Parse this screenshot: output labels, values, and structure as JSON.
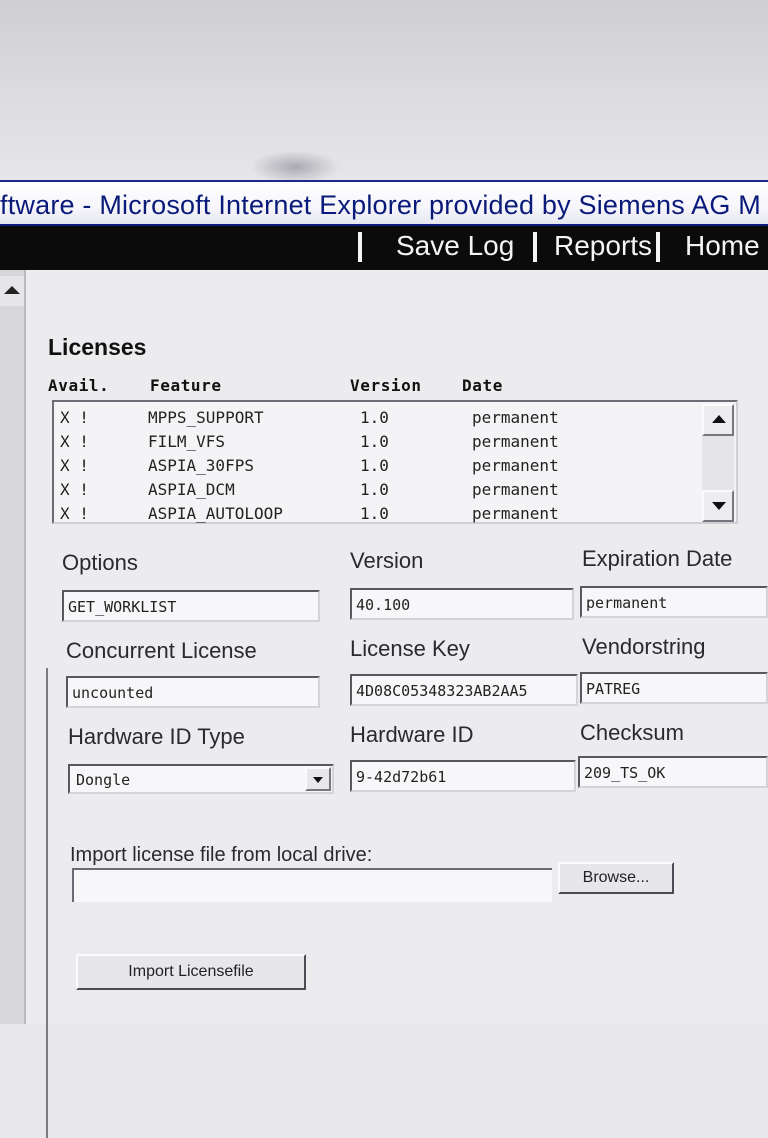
{
  "window": {
    "title": "ftware - Microsoft Internet Explorer provided by Siemens AG M"
  },
  "nav": {
    "save_log": "Save Log",
    "reports": "Reports",
    "home": "Home"
  },
  "licenses": {
    "title": "Licenses",
    "columns": {
      "avail": "Avail.",
      "feature": "Feature",
      "version": "Version",
      "date": "Date"
    },
    "rows": [
      {
        "avail": "X !",
        "feature": "MPPS_SUPPORT",
        "version": "1.0",
        "date": "permanent"
      },
      {
        "avail": "X !",
        "feature": "FILM_VFS",
        "version": "1.0",
        "date": "permanent"
      },
      {
        "avail": "X !",
        "feature": "ASPIA_30FPS",
        "version": "1.0",
        "date": "permanent"
      },
      {
        "avail": "X !",
        "feature": "ASPIA_DCM",
        "version": "1.0",
        "date": "permanent"
      },
      {
        "avail": "X !",
        "feature": "ASPIA_AUTOLOOP",
        "version": "1.0",
        "date": "permanent"
      }
    ]
  },
  "fields": {
    "options": {
      "label": "Options",
      "value": "GET_WORKLIST"
    },
    "version": {
      "label": "Version",
      "value": "40.100"
    },
    "expiration": {
      "label": "Expiration Date",
      "value": "permanent"
    },
    "concurrent": {
      "label": "Concurrent License",
      "value": "uncounted"
    },
    "license_key": {
      "label": "License Key",
      "value": "4D08C05348323AB2AA5"
    },
    "vendorstring": {
      "label": "Vendorstring",
      "value": "PATREG"
    },
    "hw_id_type": {
      "label": "Hardware ID Type",
      "value": "Dongle"
    },
    "hw_id": {
      "label": "Hardware ID",
      "value": "9-42d72b61"
    },
    "checksum": {
      "label": "Checksum",
      "value": "209_TS_OK"
    }
  },
  "import": {
    "label": "Import license file from local drive:",
    "file_value": "",
    "browse_label": "Browse...",
    "import_button": "Import Licensefile"
  }
}
